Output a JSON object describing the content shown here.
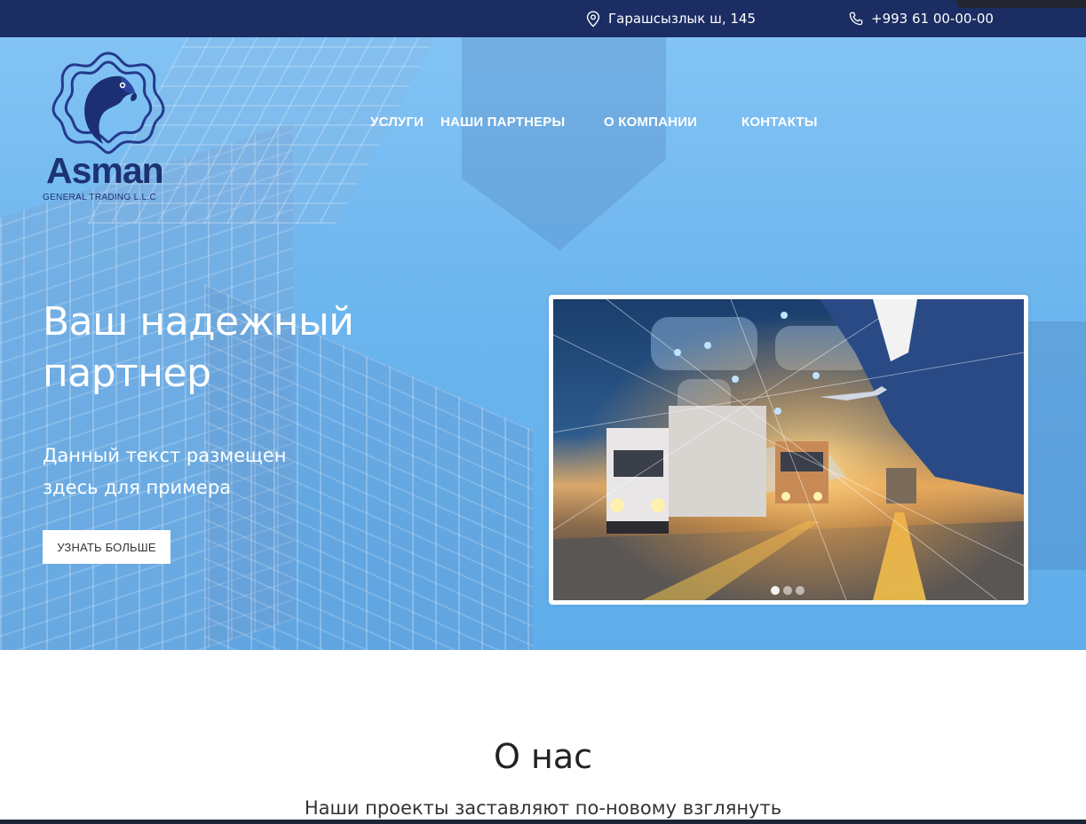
{
  "topbar": {
    "address": "Гарашсызлык ш, 145",
    "phone": "+993 61 00-00-00",
    "address_icon": "map-pin-icon",
    "phone_icon": "phone-icon",
    "background": "#1b2d62"
  },
  "logo": {
    "name": "Asman",
    "subtitle": "GENERAL TRADING L.L.C",
    "color": "#1c3272"
  },
  "nav": {
    "items": [
      {
        "label": "УСЛУГИ"
      },
      {
        "label": "НАШИ ПАРТНЕРЫ"
      },
      {
        "label": "О КОМПАНИИ"
      },
      {
        "label": "КОНТАКТЫ"
      }
    ]
  },
  "hero": {
    "title_line1": "Ваш надежный",
    "title_line2": "партнер",
    "subtitle_line1": "Данный текст размещен",
    "subtitle_line2": "здесь для примера",
    "button_label": "УЗНАТЬ БОЛЬШЕ",
    "accent": "#6cb5ee"
  },
  "slider": {
    "slide_count": 3,
    "active_slide": 1
  },
  "about": {
    "title": "О нас",
    "text": "Наши проекты заставляют по-новому взглянуть"
  }
}
